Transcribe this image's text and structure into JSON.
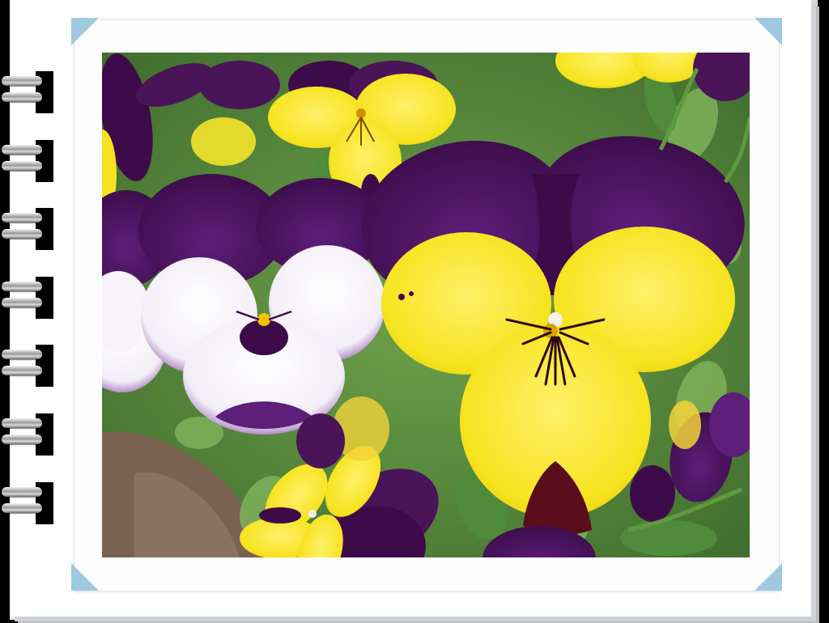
{
  "photo": {
    "subject": "pansy flowers",
    "colors": {
      "purple_dark": "#3e0b4a",
      "purple": "#5c1f7a",
      "violet": "#7b3aa2",
      "yellow": "#f6e31f",
      "yellow_deep": "#e9c400",
      "white": "#fbf7fb",
      "leaf": "#4f8b3a",
      "leaf_light": "#7fb25a",
      "soil": "#7a6250"
    }
  },
  "frame": {
    "style": "spiral-notebook",
    "ring_count": 7,
    "corner_color": "#9fc9e0"
  }
}
